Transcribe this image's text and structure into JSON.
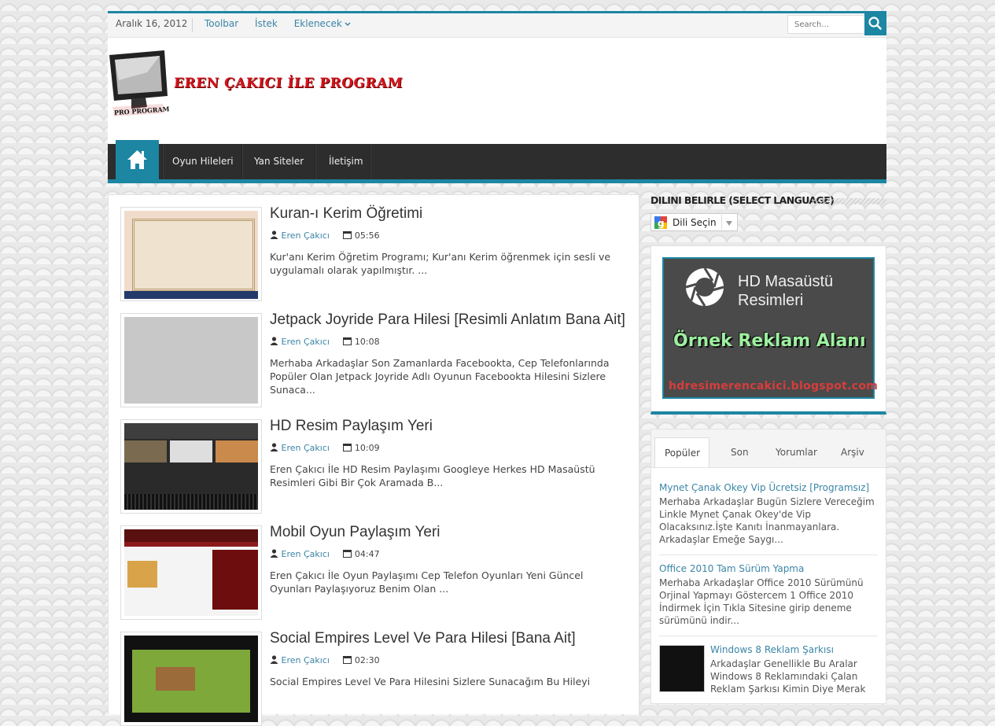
{
  "topbar": {
    "date": "Aralık 16, 2012",
    "nav": [
      "Toolbar",
      "İstek",
      "Eklenecek"
    ],
    "search_placeholder": "Search..."
  },
  "header": {
    "site_title": "EREN ÇAKICI İLE PROGRAM",
    "logo_text": "PRO PROGRAM"
  },
  "main_nav": [
    "Oyun Hileleri",
    "Yan Siteler",
    "İletişim"
  ],
  "posts": [
    {
      "title": "Kuran-ı Kerim Öğretimi",
      "author": "Eren Çakıcı",
      "time": "05:56",
      "excerpt": "Kur'anı Kerim Öğretim Programı; Kur'anı Kerim öğrenmek için sesli ve uygulamalı olarak yapılmıştır. ..."
    },
    {
      "title": "Jetpack Joyride Para Hilesi [Resimli Anlatım Bana Ait]",
      "author": "Eren Çakıcı",
      "time": "10:08",
      "excerpt": "Merhaba Arkadaşlar Son Zamanlarda Facebookta, Cep Telefonlarında Popüler Olan Jetpack Joyride Adlı Oyunun Facebookta Hilesini Sizlere Sunaca..."
    },
    {
      "title": "HD Resim Paylaşım Yeri",
      "author": "Eren Çakıcı",
      "time": "10:09",
      "excerpt": "Eren Çakıcı İle HD Resim Paylaşımı Googleye Herkes HD Masaüstü Resimleri Gibi Bir Çok Aramada B..."
    },
    {
      "title": "Mobil Oyun Paylaşım Yeri",
      "author": "Eren Çakıcı",
      "time": "04:47",
      "excerpt": "Eren Çakıcı İle Oyun Paylaşımı Cep Telefon Oyunları Yeni Güncel Oyunları Paylaşıyoruz Benim Olan ..."
    },
    {
      "title": "Social Empires Level Ve Para Hilesi [Bana Ait]",
      "author": "Eren Çakıcı",
      "time": "02:30",
      "excerpt": "Social Empires Level Ve Para Hilesini Sizlere Sunacağım Bu Hileyi"
    }
  ],
  "sidebar": {
    "language_title": "DILINI BELIRLE (SELECT LANGUAGE)",
    "language_select": "Dili Seçin",
    "ad": {
      "line1": "HD Masaüstü",
      "line2": "Resimleri",
      "banner": "Örnek Reklam Alanı",
      "url": "hdresimerencakici.blogspot.com"
    },
    "tabs": [
      "Popüler",
      "Son",
      "Yorumlar",
      "Arşiv"
    ],
    "popular": [
      {
        "title": "Mynet Çanak Okey Vip Ücretsiz [Programsız]",
        "desc": "Merhaba Arkadaşlar Bugün Sizlere Vereceğim Linkle Mynet Çanak Okey'de Vip Olacaksınız.İşte Kanıtı İnanmayanlara. Arkadaşlar Emeğe Saygı..."
      },
      {
        "title": "Office 2010 Tam Sürüm Yapma",
        "desc": "Merhaba Arkadaşlar Office 2010 Sürümünü Orjinal Yapmayı Göstercem 1  Office 2010 İndirmek İçin Tıkla  Sitesine girip deneme sürümünü indir..."
      },
      {
        "title": "Windows 8 Reklam Şarkısı",
        "desc": "Arkadaşlar Genellikle Bu Aralar Windows 8 Reklamındaki Çalan Reklam Şarkısı Kimin Diye Merak"
      }
    ]
  }
}
